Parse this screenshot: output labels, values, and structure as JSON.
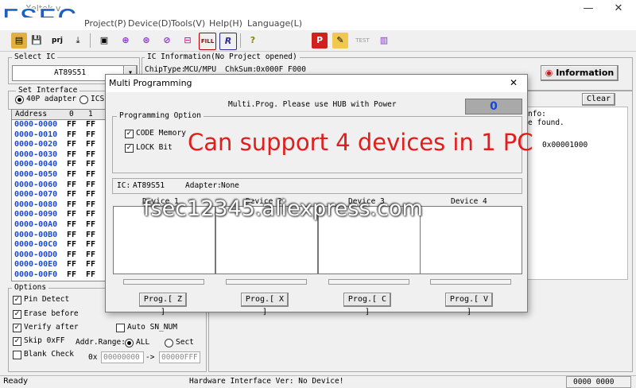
{
  "window": {
    "title": "Xeltek v",
    "minimize": "—",
    "close": "✕"
  },
  "logo": {
    "text": "FSEC"
  },
  "menu": [
    "Project(P)",
    "Device(D)",
    "Tools(V)",
    "Help(H)",
    "Language(L)"
  ],
  "toolbar": {
    "icons": [
      "folder-open-icon",
      "save-icon",
      "prj-icon",
      "load-icon",
      "save-chip-icon",
      "read-icon",
      "verify-icon",
      "blank-icon",
      "erase-icon",
      "fill-icon",
      "program-icon",
      "help-icon"
    ],
    "prj_label": "prj",
    "fill_label": "FILL",
    "right_icons": [
      "p-icon",
      "edit-icon",
      "test-icon",
      "chip-icon"
    ],
    "test_label": "TEST",
    "p_label": "P"
  },
  "select_ic": {
    "label": "Select IC",
    "value": "AT89S51"
  },
  "ic_info": {
    "label": "IC Information(No Project opened)",
    "chiptype_label": "ChipType:",
    "chiptype": "MCU/MPU",
    "chksum_label": "ChkSum:",
    "chksum": "0x000F F000"
  },
  "information_button": "Information",
  "set_interface": {
    "label": "Set Interface",
    "adapter": "40P adapter",
    "icsp": "ICSP"
  },
  "hex": {
    "headers": [
      "Address",
      "0",
      "1"
    ],
    "rows": [
      {
        "addr": "0000-0000",
        "b0": "FF",
        "b1": "FF"
      },
      {
        "addr": "0000-0010",
        "b0": "FF",
        "b1": "FF"
      },
      {
        "addr": "0000-0020",
        "b0": "FF",
        "b1": "FF"
      },
      {
        "addr": "0000-0030",
        "b0": "FF",
        "b1": "FF"
      },
      {
        "addr": "0000-0040",
        "b0": "FF",
        "b1": "FF"
      },
      {
        "addr": "0000-0050",
        "b0": "FF",
        "b1": "FF"
      },
      {
        "addr": "0000-0060",
        "b0": "FF",
        "b1": "FF"
      },
      {
        "addr": "0000-0070",
        "b0": "FF",
        "b1": "FF"
      },
      {
        "addr": "0000-0080",
        "b0": "FF",
        "b1": "FF"
      },
      {
        "addr": "0000-0090",
        "b0": "FF",
        "b1": "FF"
      },
      {
        "addr": "0000-00A0",
        "b0": "FF",
        "b1": "FF"
      },
      {
        "addr": "0000-00B0",
        "b0": "FF",
        "b1": "FF"
      },
      {
        "addr": "0000-00C0",
        "b0": "FF",
        "b1": "FF"
      },
      {
        "addr": "0000-00D0",
        "b0": "FF",
        "b1": "FF"
      },
      {
        "addr": "0000-00E0",
        "b0": "FF",
        "b1": "FF"
      },
      {
        "addr": "0000-00F0",
        "b0": "FF",
        "b1": "FF"
      }
    ]
  },
  "log": {
    "clear": "Clear",
    "line1": "nfo:",
    "line2": "e found.",
    "line3": "0x00001000"
  },
  "options": {
    "label": "Options",
    "pin_detect": "Pin Detect",
    "erase_before": "Erase before",
    "verify_after": "Verify after",
    "skip_off": "Skip 0xFF",
    "blank_check": "Blank Check",
    "auto_sn": "Auto SN_NUM",
    "addr_range": "Addr.Range:",
    "all": "ALL",
    "sect": "Sect",
    "ox": "0x",
    "from": "00000000",
    "arrow": "->",
    "to": "00000FFF"
  },
  "status": {
    "ready": "Ready",
    "hw": "Hardware Interface Ver: No Device!",
    "code": "0000 0000"
  },
  "dialog": {
    "title": "Multi Programming",
    "close": "✕",
    "hint": "Multi.Prog. Please use HUB with Power",
    "count": "0",
    "prog_option": "Programming Option",
    "code_memory": "CODE Memory",
    "lock_bit": "LOCK Bit",
    "ic_label": "IC:",
    "ic": "AT89S51",
    "adapter_label": "Adapter:",
    "adapter": "None",
    "devices": [
      "Device 1",
      "Device 2",
      "Device 3",
      "Device 4"
    ],
    "buttons": [
      "Prog.[ Z ]",
      "Prog.[ X ]",
      "Prog.[ C ]",
      "Prog.[ V ]"
    ]
  },
  "overlay": {
    "headline": "Can support 4 devices in 1 PC",
    "watermark": "fsec12345.aliexpress.com"
  },
  "colors": {
    "accent_blue": "#1a47d8",
    "overlay_red": "#e11d1d",
    "count_bg": "#a9a9a9",
    "logo_blue": "#1d5fbf"
  }
}
